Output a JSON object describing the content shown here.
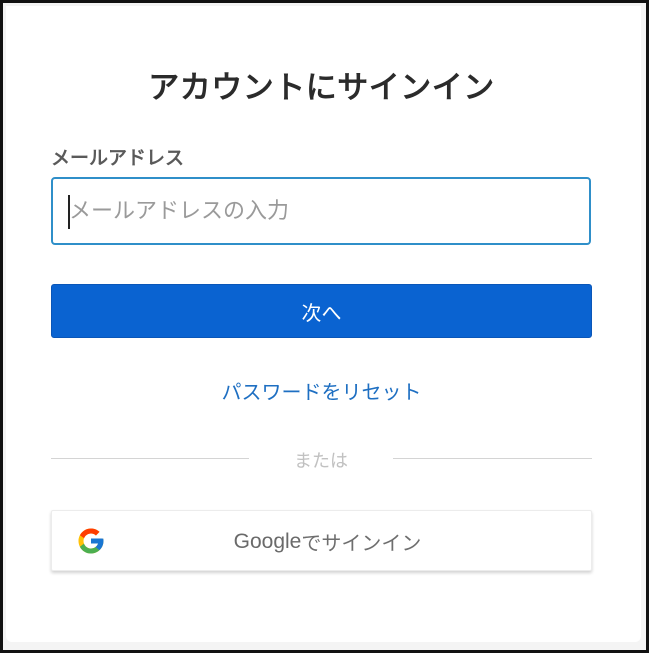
{
  "signin": {
    "title": "アカウントにサインイン",
    "email_label": "メールアドレス",
    "email_placeholder": "メールアドレスの入力",
    "email_value": "",
    "next_button_label": "次へ",
    "reset_password_link": "パスワードをリセット",
    "divider_text": "または",
    "google_button_brand": "Google",
    "google_button_suffix": "でサインイン"
  },
  "colors": {
    "primary_button": "#0a63d1",
    "link": "#1e6fc2",
    "input_border_focus": "#2f8fc9",
    "title_text": "#2b2b2b"
  },
  "icons": {
    "google": "google-g-logo-icon"
  }
}
